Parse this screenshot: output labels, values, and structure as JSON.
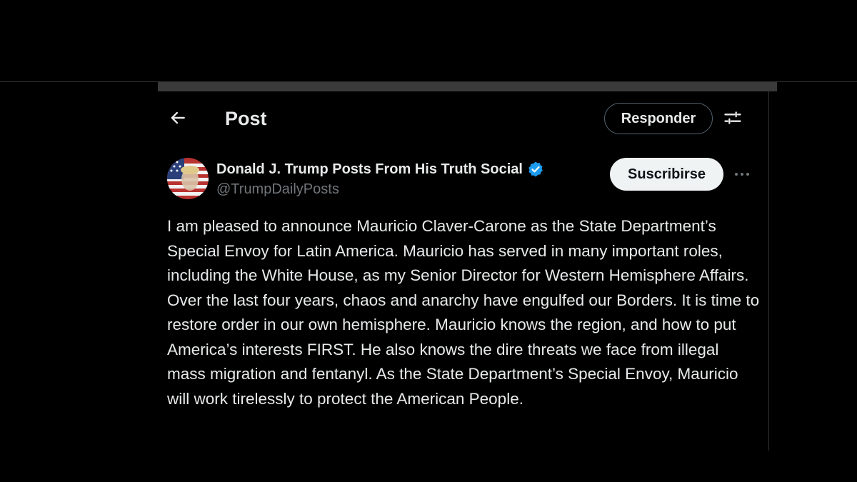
{
  "header": {
    "title": "Post",
    "reply_label": "Responder",
    "back_icon": "arrow-left-icon",
    "settings_icon": "sliders-icon"
  },
  "post": {
    "author_name": "Donald J. Trump Posts From His Truth Social",
    "handle": "@TrumpDailyPosts",
    "verified": true,
    "subscribe_label": "Suscribirse",
    "more_icon": "more-horizontal-icon",
    "body": "I am pleased to announce Mauricio Claver-Carone as the State Department’s Special Envoy for Latin America. Mauricio has served in many important roles, including the White House, as my Senior Director for Western Hemisphere Affairs. Over the last four years, chaos and anarchy have engulfed our Borders. It is time to restore order in our own hemisphere. Mauricio knows the region, and how to put America’s interests FIRST. He also knows the dire threats we face from illegal mass migration and fentanyl. As the State Department’s Special Envoy, Mauricio will work tirelessly to protect the American People."
  },
  "colors": {
    "background": "#000000",
    "text_primary": "#e7e9ea",
    "text_secondary": "#71767b",
    "verified_blue": "#1d9bf0",
    "border": "#2f3336"
  }
}
